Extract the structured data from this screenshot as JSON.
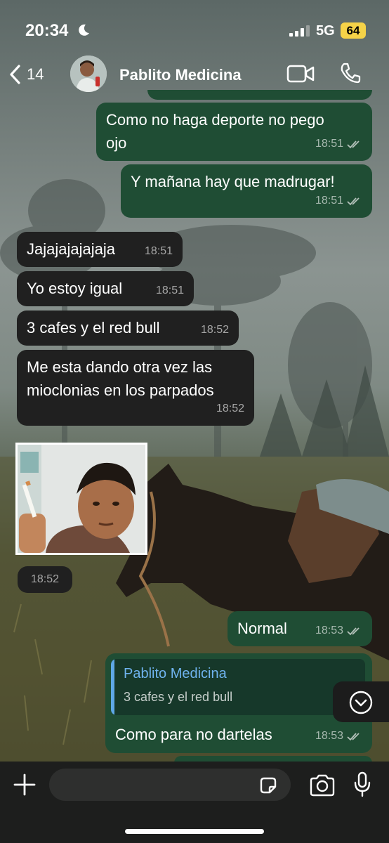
{
  "status_bar": {
    "time": "20:34",
    "network": "5G",
    "battery": "64"
  },
  "header": {
    "back_count": "14",
    "contact_name": "Pablito Medicina"
  },
  "messages": [
    {
      "direction": "out",
      "text_lines": [
        "Como no haga deporte no pego",
        "ojo"
      ],
      "time": "18:51"
    },
    {
      "direction": "out",
      "text": "Y mañana hay que madrugar!",
      "time": "18:51"
    },
    {
      "direction": "in",
      "text": "Jajajajajajaja",
      "time": "18:51"
    },
    {
      "direction": "in",
      "text": "Yo estoy igual",
      "time": "18:51"
    },
    {
      "direction": "in",
      "text": "3 cafes y el red bull",
      "time": "18:52"
    },
    {
      "direction": "in",
      "text_lines": [
        "Me esta dando otra vez las",
        "mioclonias en los parpados"
      ],
      "time": "18:52"
    },
    {
      "direction": "in",
      "type": "image",
      "time": "18:52"
    },
    {
      "direction": "out",
      "text": "Normal",
      "time": "18:53"
    },
    {
      "direction": "out",
      "reply_to": {
        "author": "Pablito Medicina",
        "text": "3 cafes y el red bull"
      },
      "text": "Como para no dartelas",
      "time": "18:53"
    }
  ],
  "colors": {
    "outgoing_bubble": "#1f4d34",
    "incoming_bubble": "#202020",
    "reply_accent": "#5ea8e7"
  },
  "icons": [
    "moon-icon",
    "signal-icon",
    "back-chevron-icon",
    "video-call-icon",
    "phone-icon",
    "read-ticks-icon",
    "chevron-down-icon",
    "plus-icon",
    "sticker-icon",
    "camera-icon",
    "microphone-icon"
  ]
}
